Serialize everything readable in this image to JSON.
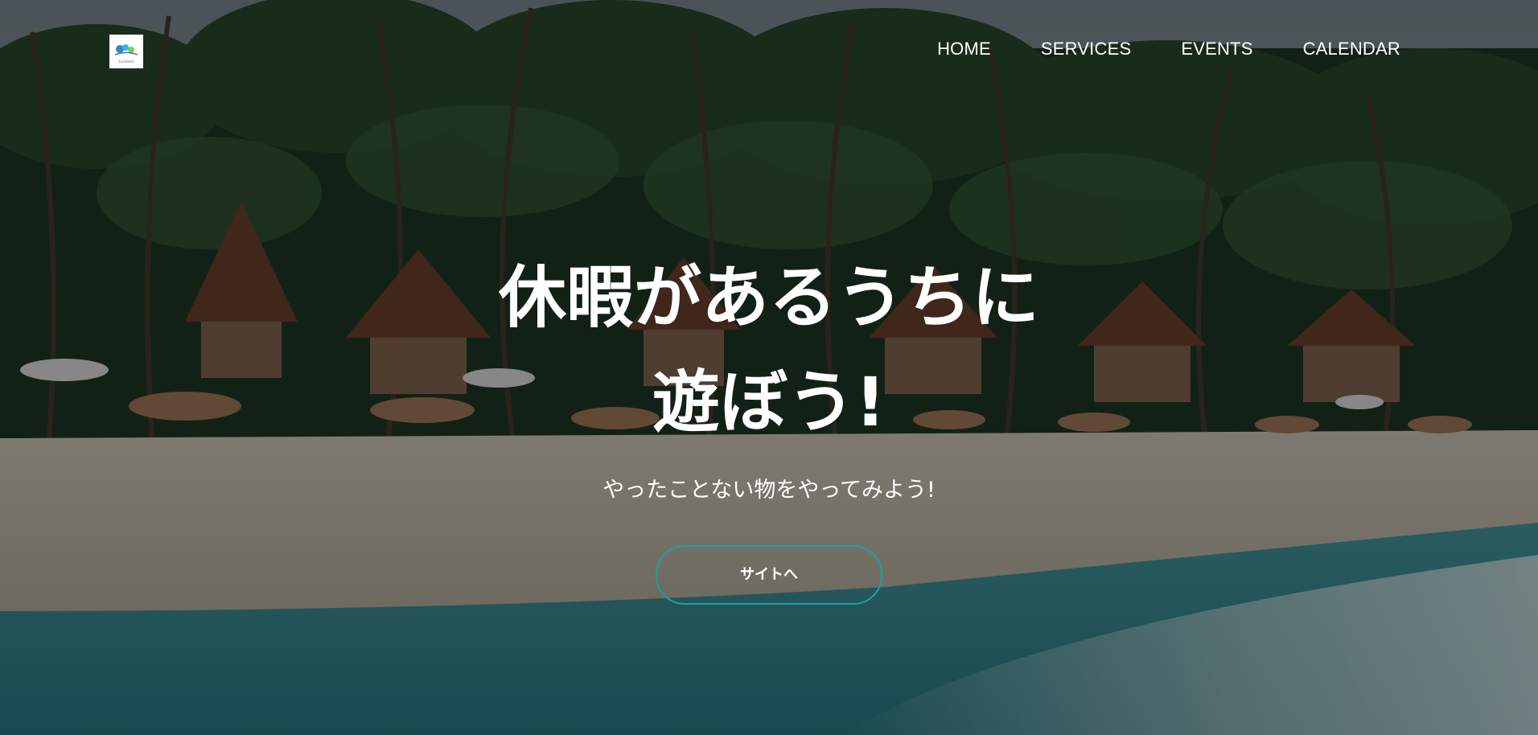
{
  "header": {
    "logo_alt": "Excellent",
    "nav": [
      {
        "label": "HOME"
      },
      {
        "label": "SERVICES"
      },
      {
        "label": "EVENTS"
      },
      {
        "label": "CALENDAR"
      }
    ]
  },
  "hero": {
    "title_line1": "休暇があるうちに",
    "title_line2": "遊ぼう!",
    "subtitle": "やったことない物をやってみよう!",
    "cta_label": "サイトへ",
    "background": "beach-resort-palm-trees"
  },
  "colors": {
    "accent": "#17a2a0",
    "overlay": "rgba(0,0,0,0.42)",
    "text": "#ffffff"
  }
}
